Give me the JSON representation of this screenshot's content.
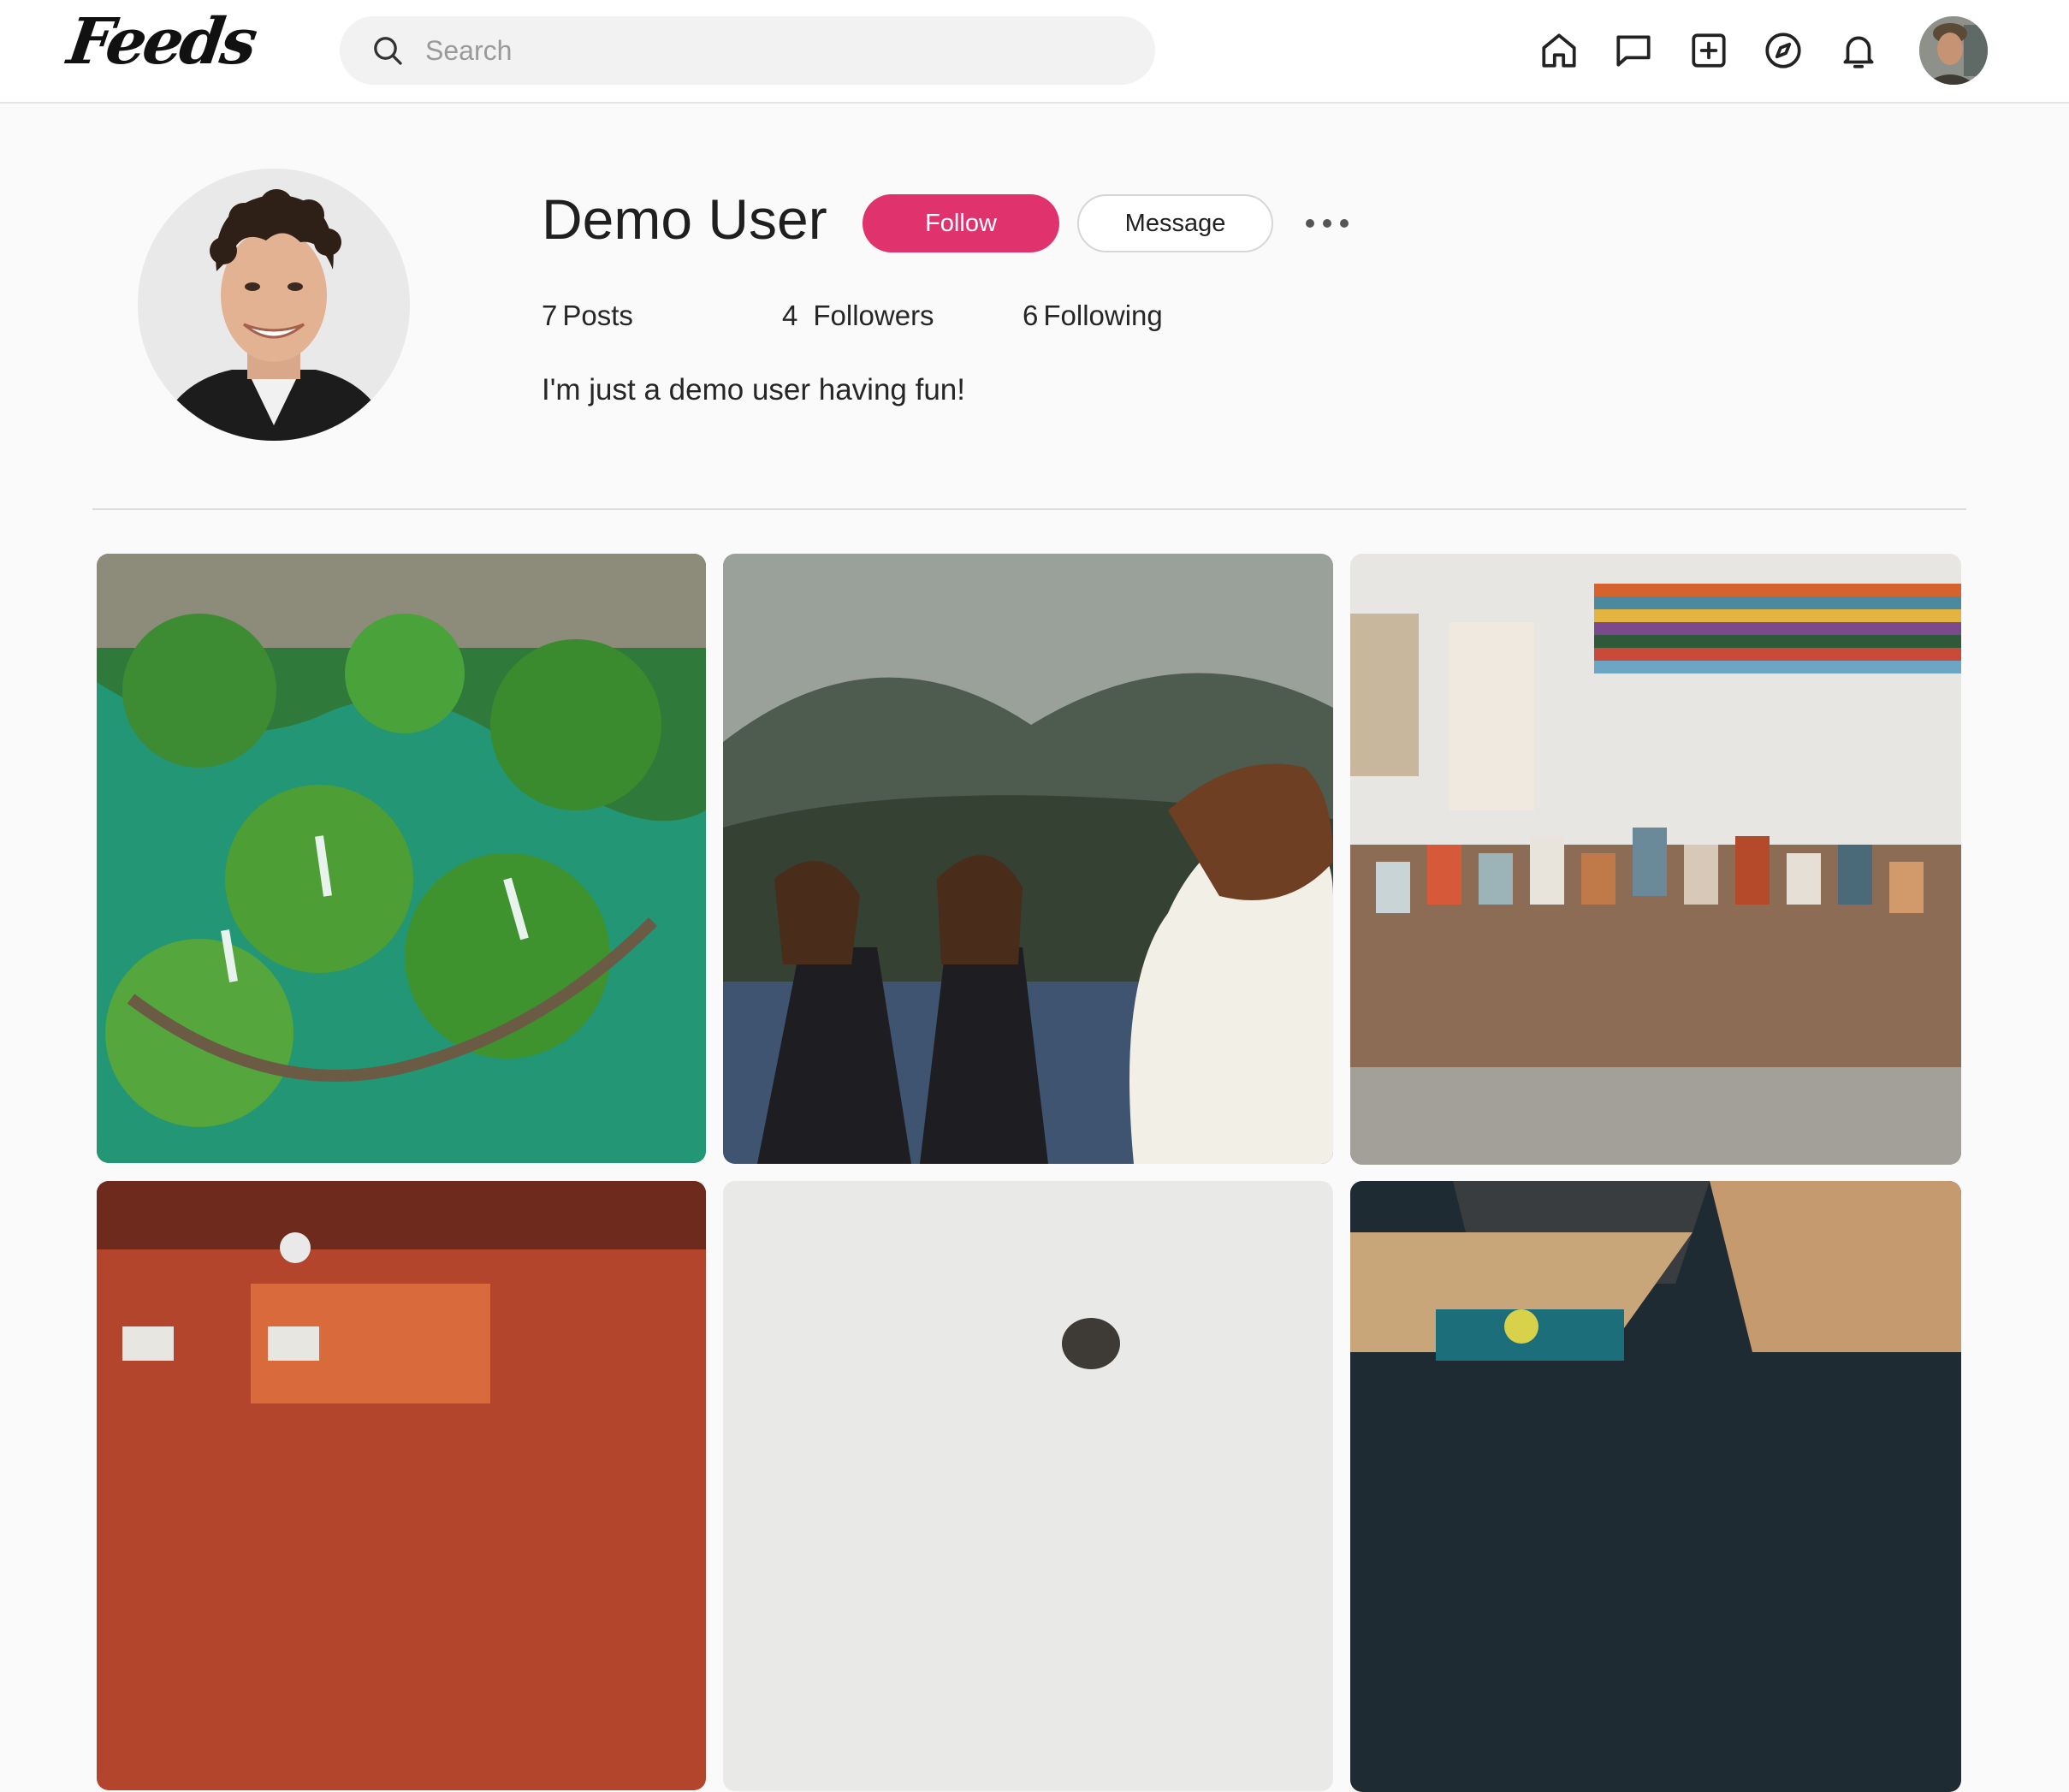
{
  "header": {
    "logo": "Feeds",
    "search": {
      "placeholder": "Search",
      "value": ""
    },
    "nav": [
      "home-icon",
      "messages-icon",
      "create-post-icon",
      "explore-icon",
      "notifications-icon"
    ]
  },
  "profile": {
    "name": "Demo User",
    "follow_label": "Follow",
    "message_label": "Message",
    "stats": {
      "posts_count": "7",
      "posts_label": "Posts",
      "followers_count": "4",
      "followers_label": "Followers",
      "following_count": "6",
      "following_label": "Following"
    },
    "bio": "I'm just a demo user having fun!"
  },
  "colors": {
    "accent": "#e0336e",
    "background": "#fafafa",
    "header_bg": "#ffffff"
  }
}
